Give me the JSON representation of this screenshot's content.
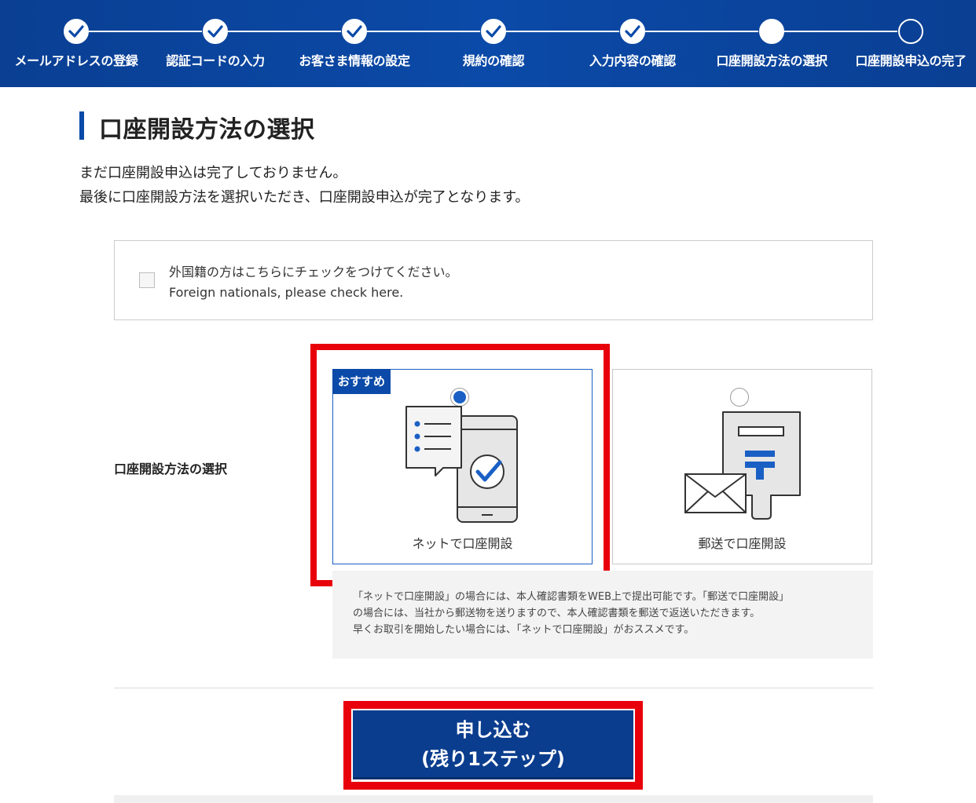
{
  "progress": {
    "steps": [
      {
        "label": "メールアドレスの登録",
        "state": "done"
      },
      {
        "label": "認証コードの入力",
        "state": "done"
      },
      {
        "label": "お客さま情報の設定",
        "state": "done"
      },
      {
        "label": "規約の確認",
        "state": "done"
      },
      {
        "label": "入力内容の確認",
        "state": "done"
      },
      {
        "label": "口座開設方法の選択",
        "state": "current"
      },
      {
        "label": "口座開設申込の完了",
        "state": "todo"
      }
    ]
  },
  "page": {
    "title": "口座開設方法の選択",
    "intro_line1": "まだ口座開設申込は完了しておりません。",
    "intro_line2": "最後に口座開設方法を選択いただき、口座開設申込が完了となります。"
  },
  "foreign": {
    "line_ja": "外国籍の方はこちらにチェックをつけてください。",
    "line_en": "Foreign nationals, please check here.",
    "checked": false
  },
  "method": {
    "label": "口座開設方法の選択",
    "options": [
      {
        "caption": "ネットで口座開設",
        "badge": "おすすめ",
        "selected": true,
        "icon": "smartphone-check-icon"
      },
      {
        "caption": "郵送で口座開設",
        "badge": "",
        "selected": false,
        "icon": "postal-mail-icon"
      }
    ],
    "note_line1": "「ネットで口座開設」の場合には、本人確認書類をWEB上で提出可能です。「郵送で口座開設」",
    "note_line2": "の場合には、当社から郵送物を送りますので、本人確認書類を郵送で返送いただきます。",
    "note_line3": "早くお取引を開始したい場合には、「ネットで口座開設」がおススメです。"
  },
  "submit": {
    "line1": "申し込む",
    "line2": "(残り1ステップ)"
  },
  "colors": {
    "brand_blue": "#0b4aa8",
    "highlight_red": "#e8000b",
    "selected_blue": "#1a5fc4"
  }
}
